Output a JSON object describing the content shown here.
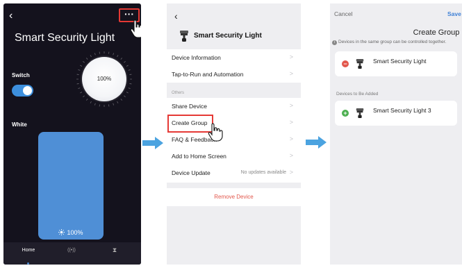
{
  "screen1": {
    "back_icon": "chevron-left-icon",
    "more_icon": "more-horizontal-icon",
    "more_glyph": "···",
    "title": "Smart Security Light",
    "switch_label": "Switch",
    "switch_on": true,
    "brightness_dial": "100%",
    "white_label": "White",
    "brightness_value": "100%",
    "brightness_icon": "sun-icon",
    "nav": {
      "home_label": "Home",
      "radar_icon": "radar-icon",
      "radar_glyph": "((•))",
      "timer_icon": "hourglass-icon",
      "timer_glyph": "⧗"
    },
    "colors": {
      "background": "#14121d",
      "accent": "#4f8fd6"
    }
  },
  "screen2": {
    "back_icon": "chevron-left-icon",
    "device_name": "Smart Security Light",
    "items_top": [
      {
        "label": "Device Information"
      },
      {
        "label": "Tap-to-Run and Automation"
      }
    ],
    "others_section_label": "Others",
    "items_others": [
      {
        "label": "Share Device"
      },
      {
        "label": "Create Group"
      },
      {
        "label": "FAQ & Feedback"
      },
      {
        "label": "Add to Home Screen"
      },
      {
        "label": "Device Update",
        "value": "No updates available"
      }
    ],
    "remove_label": "Remove Device",
    "colors": {
      "highlight": "#e53935",
      "danger": "#e2574c"
    }
  },
  "screen3": {
    "cancel_label": "Cancel",
    "save_label": "Save",
    "title": "Create Group",
    "info_text": "Devices in the same group can be controlled together.",
    "group_devices": [
      {
        "name": "Smart Security Light",
        "action": "remove"
      }
    ],
    "to_be_added_label": "Devices to Be Added",
    "candidate_devices": [
      {
        "name": "Smart Security Light 3",
        "action": "add"
      }
    ],
    "colors": {
      "remove": "#e2574c",
      "add": "#4caf50",
      "save": "#3d7fd6"
    }
  }
}
